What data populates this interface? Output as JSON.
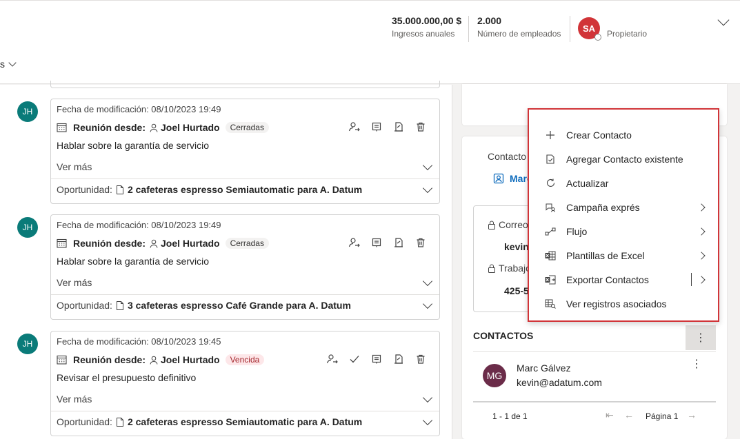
{
  "header": {
    "kpi1": {
      "value": "35.000.000,00 $",
      "label": "Ingresos anuales"
    },
    "kpi2": {
      "value": "2.000",
      "label": "Número de empleados"
    },
    "owner": {
      "initials": "SA",
      "label": "Propietario",
      "color": "#d13438"
    },
    "left_fragment": "s"
  },
  "timeline": [
    {
      "initials": "JH",
      "modified": "Fecha de modificación: 08/10/2023 19:49",
      "type": "Reunión desde:",
      "person": "Joel Hurtado",
      "status": "Cerradas",
      "description": "Hablar sobre la garantía de servicio",
      "more": "Ver más",
      "opp_label": "Oportunidad:",
      "opp_value": "2 cafeteras espresso Semiautomatic para A. Datum"
    },
    {
      "initials": "JH",
      "modified": "Fecha de modificación: 08/10/2023 19:49",
      "type": "Reunión desde:",
      "person": "Joel Hurtado",
      "status": "Cerradas",
      "description": "Hablar sobre la garantía de servicio",
      "more": "Ver más",
      "opp_label": "Oportunidad:",
      "opp_value": "3 cafeteras espresso Café Grande para A. Datum"
    },
    {
      "initials": "JH",
      "modified": "Fecha de modificación: 08/10/2023 19:45",
      "type": "Reunión desde:",
      "person": "Joel Hurtado",
      "status": "Vencida",
      "description": "Revisar el presupuesto definitivo",
      "more": "Ver más",
      "opp_label": "Oportunidad:",
      "opp_value": "2 cafeteras espresso Semiautomatic para A. Datum"
    }
  ],
  "contact_panel": {
    "label": "Contacto",
    "link": "Marc",
    "email_label": "Correo",
    "email_val": "kevin",
    "work_label": "Trabajo",
    "work_val": "425-5"
  },
  "contacts": {
    "title": "CONTACTOS",
    "item": {
      "initials": "MG",
      "name": "Marc Gálvez",
      "email": "kevin@adatum.com",
      "color": "#6b2c49"
    },
    "paging": {
      "range": "1 - 1 de 1",
      "page": "Página 1"
    }
  },
  "menu": [
    {
      "label": "Crear Contacto",
      "icon": "plus-icon",
      "submenu": false
    },
    {
      "label": "Agregar Contacto existente",
      "icon": "add-existing-icon",
      "submenu": false
    },
    {
      "label": "Actualizar",
      "icon": "refresh-icon",
      "submenu": false
    },
    {
      "label": "Campaña exprés",
      "icon": "campaign-icon",
      "submenu": true
    },
    {
      "label": "Flujo",
      "icon": "flow-icon",
      "submenu": true
    },
    {
      "label": "Plantillas de Excel",
      "icon": "excel-template-icon",
      "submenu": true
    },
    {
      "label": "Exportar Contactos",
      "icon": "excel-export-icon",
      "submenu": true
    },
    {
      "label": "Ver registros asociados",
      "icon": "associated-records-icon",
      "submenu": false
    }
  ]
}
